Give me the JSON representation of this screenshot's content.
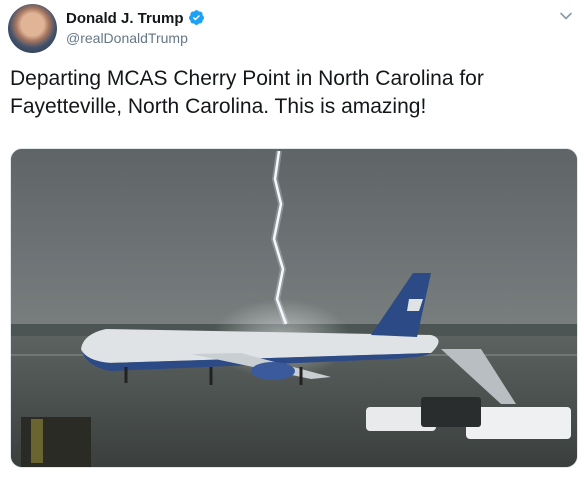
{
  "tweet": {
    "author_name": "Donald J. Trump",
    "handle": "@realDonaldTrump",
    "text": "Departing MCAS Cherry Point in North Carolina for Fayetteville, North Carolina. This is amazing!"
  },
  "icons": {
    "verified": "verified-badge-icon",
    "menu": "chevron-down-icon"
  },
  "colors": {
    "verified": "#1da1f2",
    "name_text": "#14171a",
    "secondary_text": "#657786"
  }
}
